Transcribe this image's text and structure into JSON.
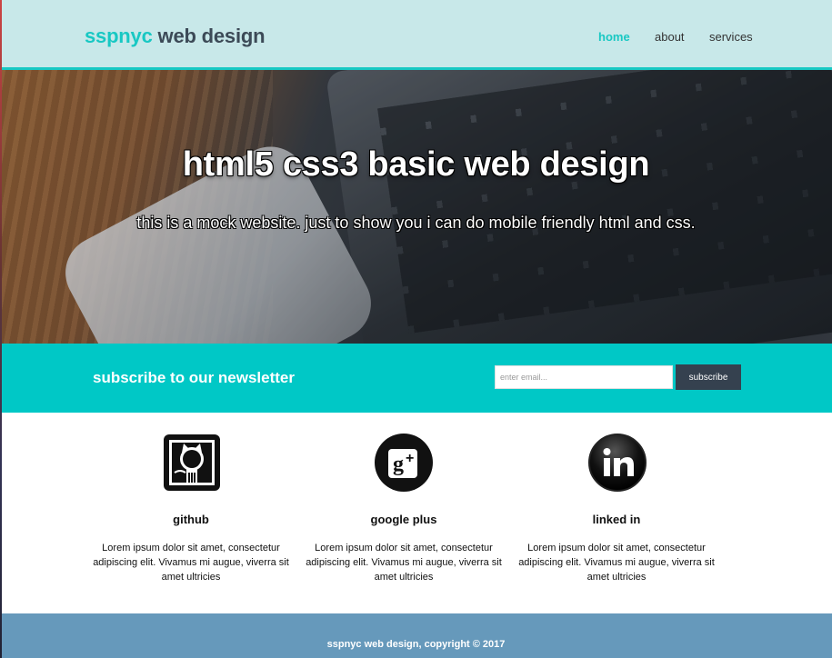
{
  "header": {
    "brand_highlight": "sspnyc",
    "brand_rest": "web design",
    "nav": [
      {
        "label": "home",
        "active": true
      },
      {
        "label": "about",
        "active": false
      },
      {
        "label": "services",
        "active": false
      }
    ]
  },
  "hero": {
    "title": "html5 css3 basic web design",
    "subtitle": "this is a mock website. just to show you i can do mobile friendly html and css."
  },
  "newsletter": {
    "heading": "subscribe to our newsletter",
    "email_placeholder": "enter email...",
    "button_label": "subscribe"
  },
  "boxes": [
    {
      "icon": "github-icon",
      "title": "github",
      "text": "Lorem ipsum dolor sit amet, consectetur adipiscing elit. Vivamus mi augue, viverra sit amet ultricies"
    },
    {
      "icon": "google-plus-icon",
      "title": "google plus",
      "text": "Lorem ipsum dolor sit amet, consectetur adipiscing elit. Vivamus mi augue, viverra sit amet ultricies"
    },
    {
      "icon": "linkedin-icon",
      "title": "linked in",
      "text": "Lorem ipsum dolor sit amet, consectetur adipiscing elit. Vivamus mi augue, viverra sit amet ultricies"
    }
  ],
  "footer": {
    "text": "sspnyc web design, copyright © 2017"
  },
  "colors": {
    "accent": "#18c8c3",
    "header_bg": "#c8e8e9",
    "newsletter_bg": "#00c8c6",
    "button_bg": "#35414f",
    "footer_bg": "#6699bb"
  }
}
